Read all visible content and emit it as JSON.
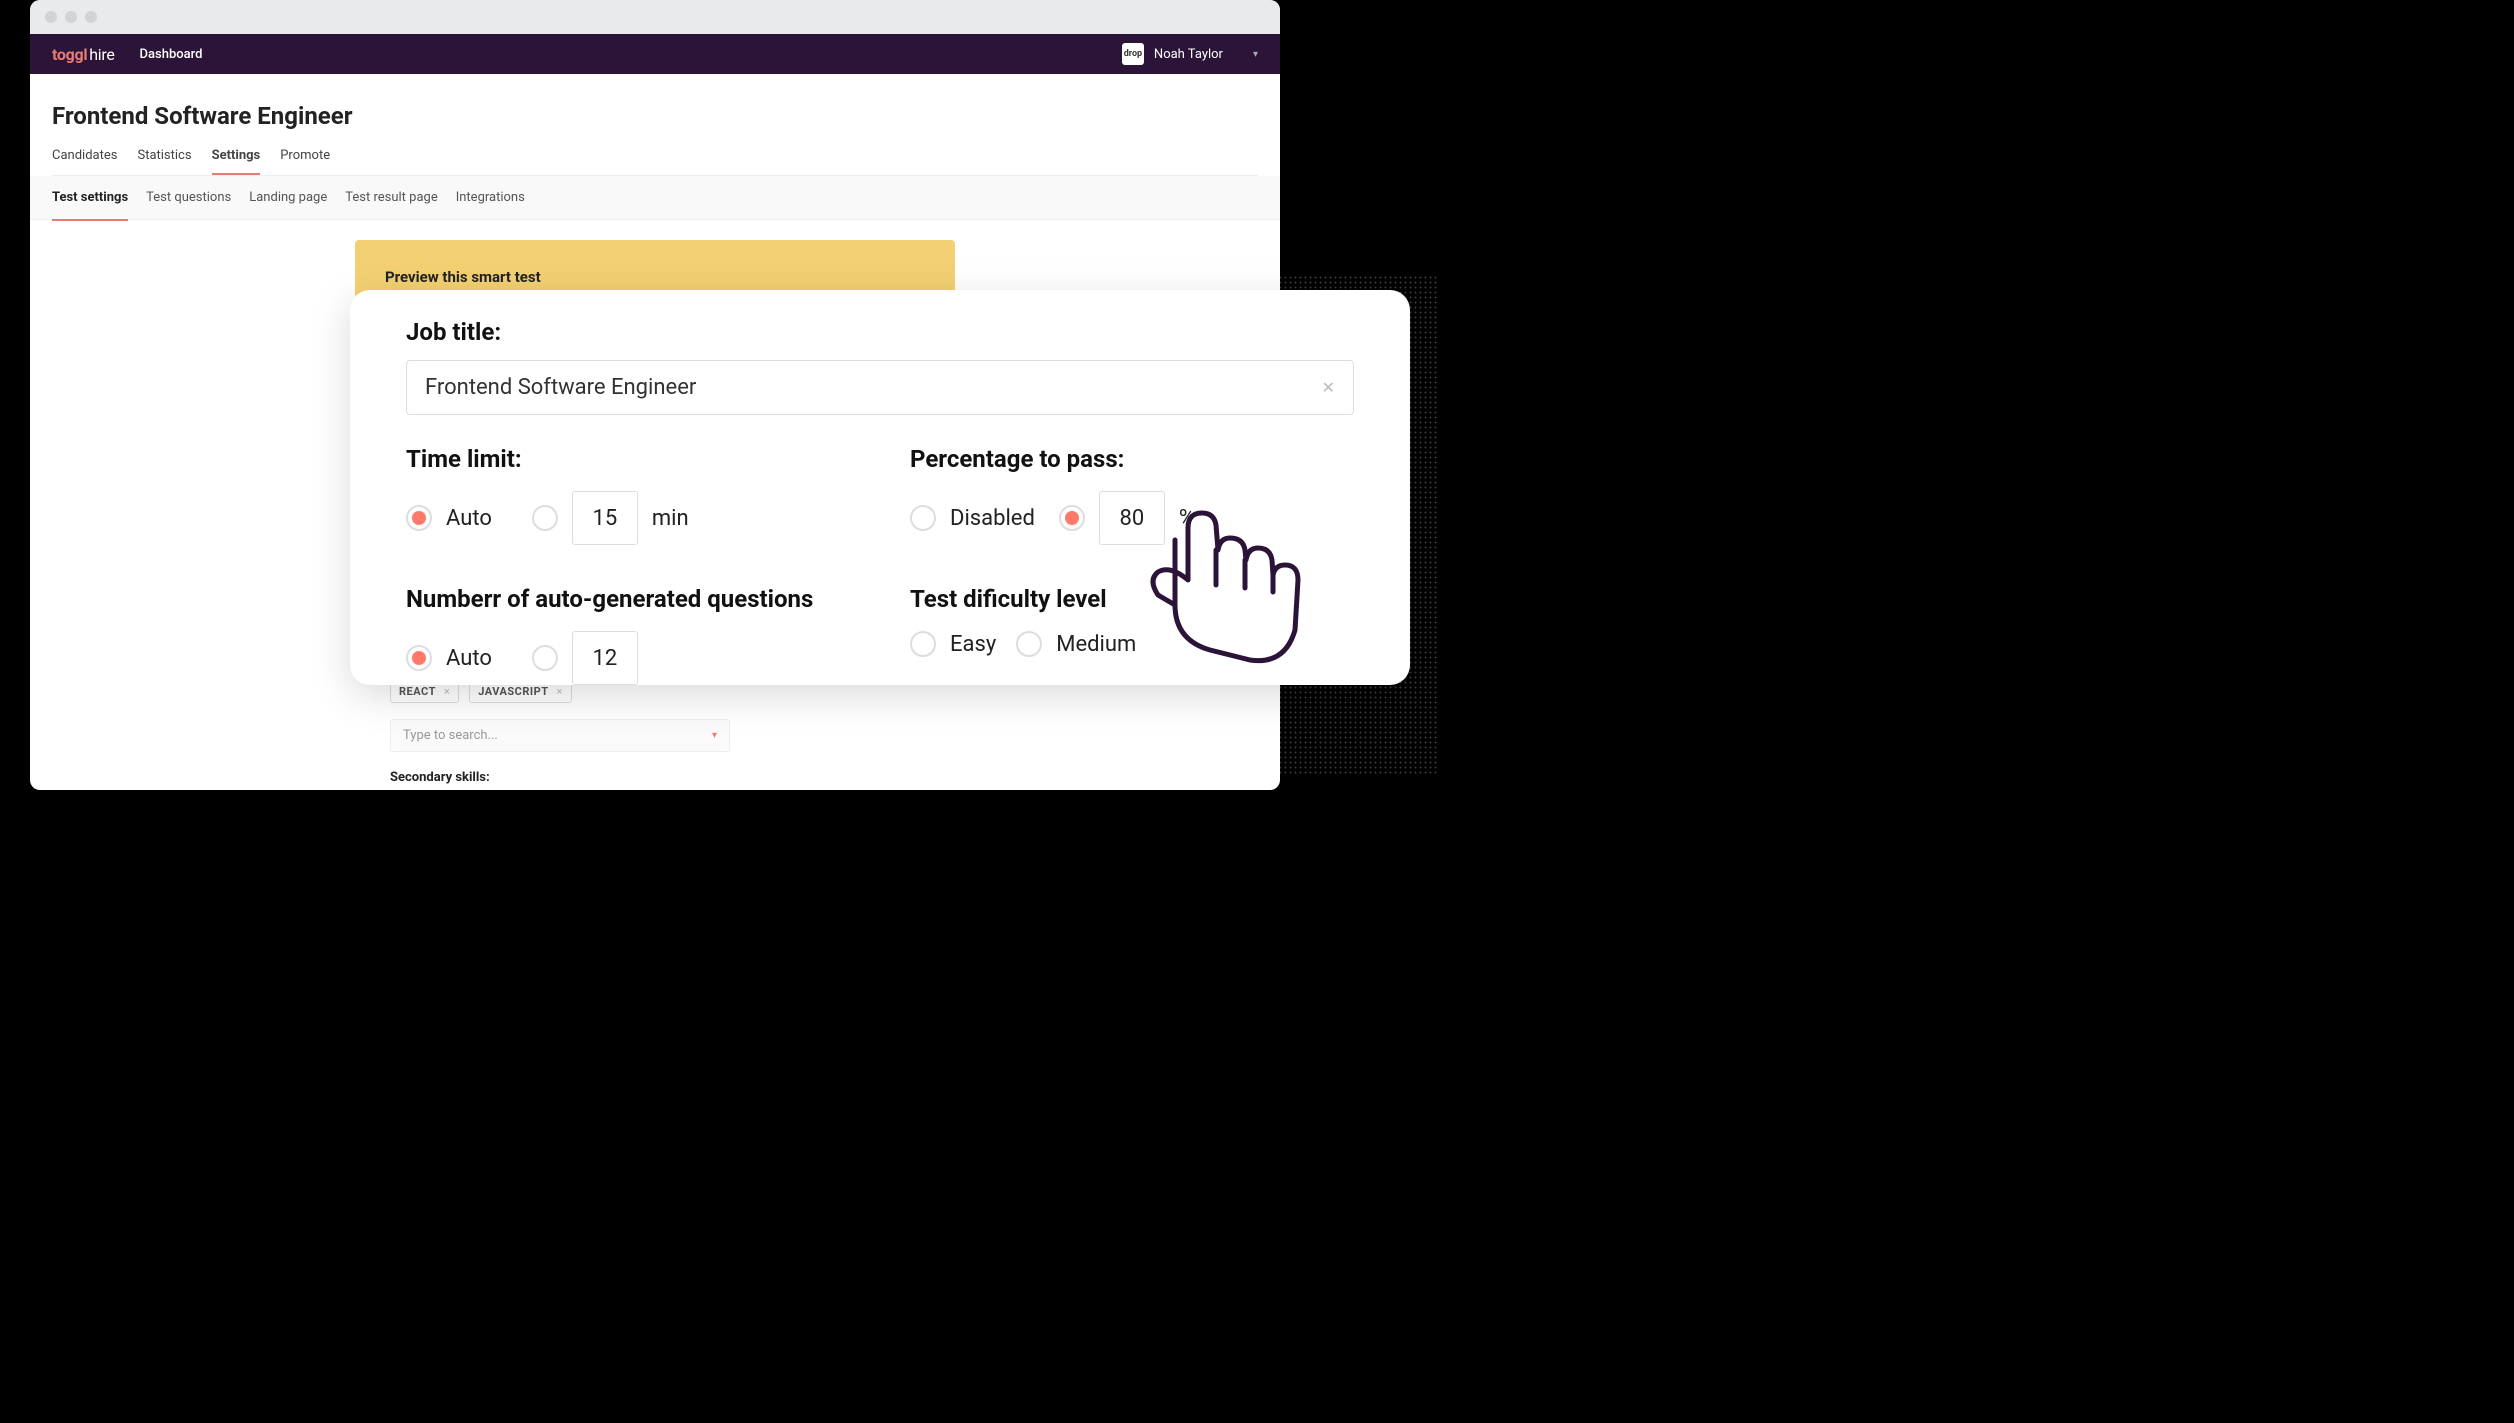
{
  "topbar": {
    "logo": "toggl",
    "logo_suffix": "hire",
    "nav": "Dashboard",
    "avatar_label": "drop",
    "username": "Noah Taylor"
  },
  "page": {
    "title": "Frontend Software Engineer",
    "tabs": {
      "candidates": "Candidates",
      "statistics": "Statistics",
      "settings": "Settings",
      "promote": "Promote"
    },
    "subtabs": {
      "test_settings": "Test settings",
      "test_questions": "Test questions",
      "landing_page": "Landing page",
      "test_result_page": "Test result page",
      "integrations": "Integrations"
    },
    "preview_banner": "Preview this smart test"
  },
  "modal": {
    "job_title_label": "Job title:",
    "job_title_value": "Frontend Software Engineer",
    "time_limit_label": "Time limit:",
    "time_limit_auto": "Auto",
    "time_limit_value": "15",
    "time_limit_unit": "min",
    "questions_label": "Numberr of auto-generated questions",
    "questions_auto": "Auto",
    "questions_value": "12",
    "percentage_label": "Percentage to pass:",
    "percentage_disabled": "Disabled",
    "percentage_value": "80",
    "percentage_unit": "%",
    "difficulty_label": "Test dificulty level",
    "difficulty_easy": "Easy",
    "difficulty_medium": "Medium"
  },
  "skills": {
    "chip_react": "REACT",
    "chip_js": "JAVASCRIPT",
    "search_placeholder": "Type to search...",
    "secondary_label": "Secondary skills:"
  }
}
